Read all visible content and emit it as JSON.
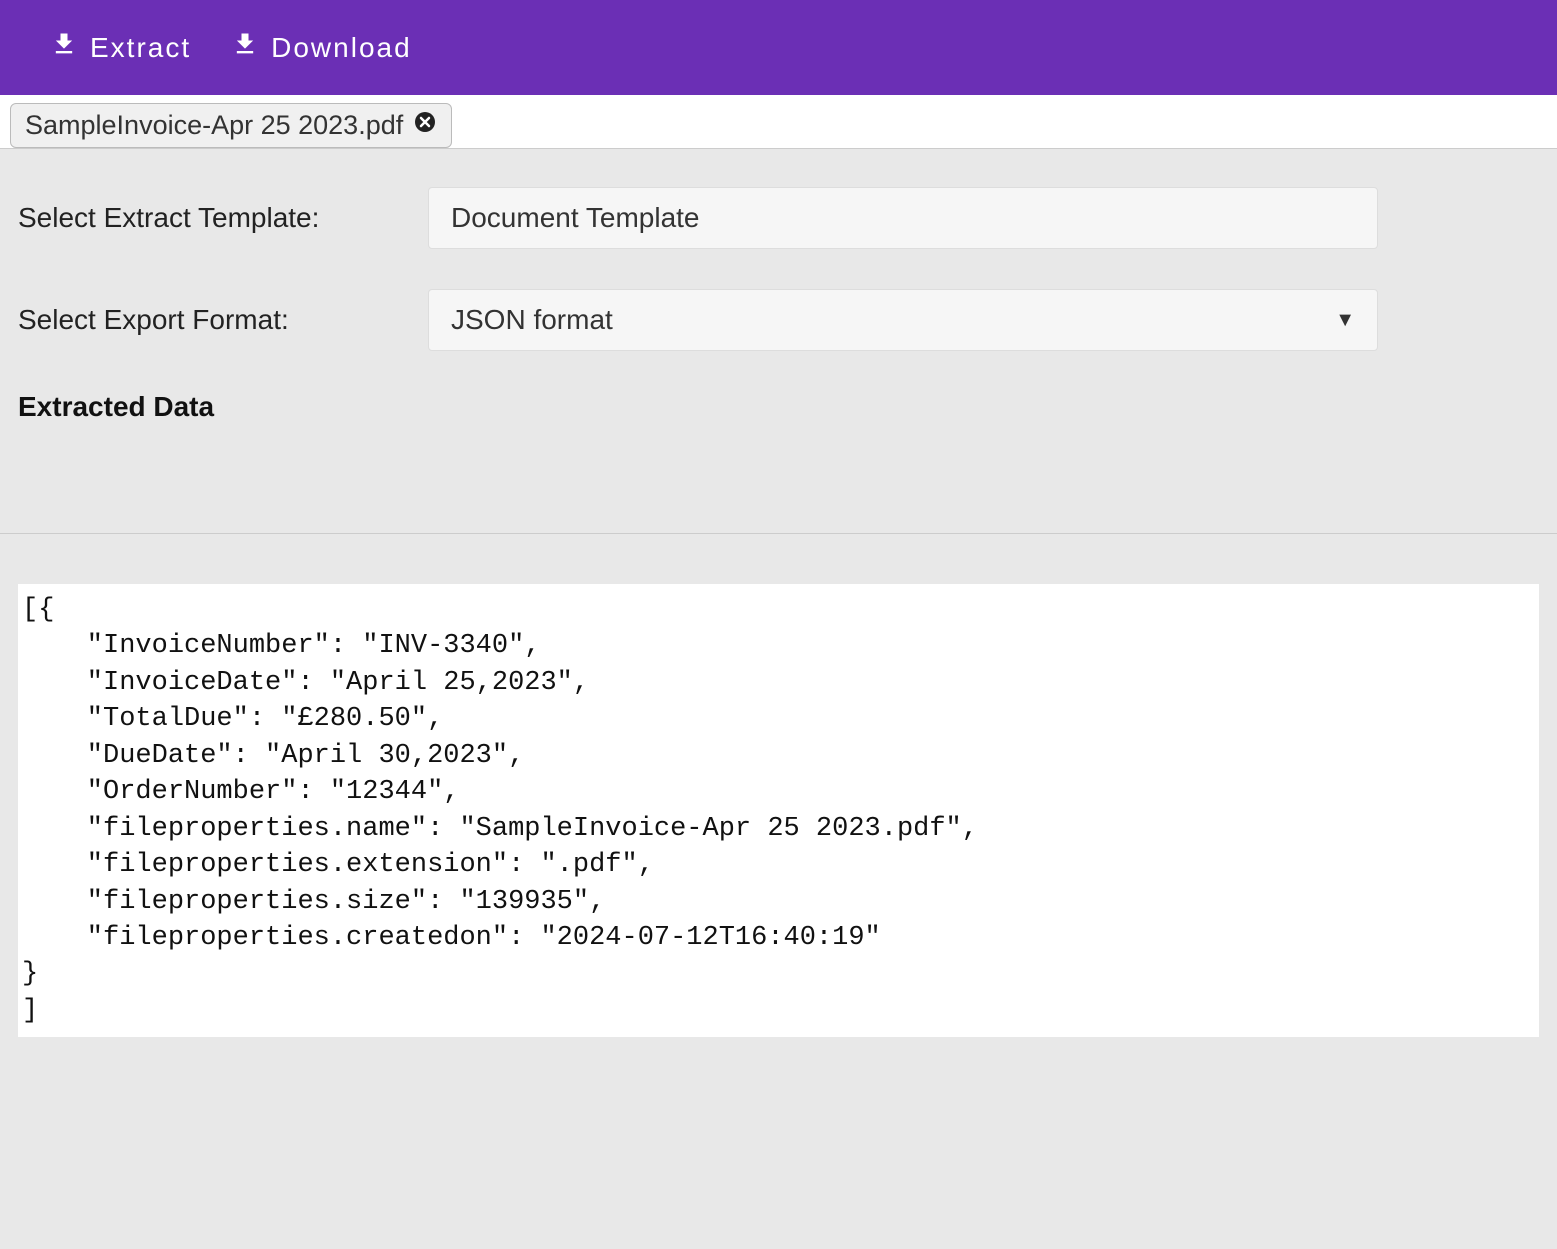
{
  "toolbar": {
    "extract_label": "Extract",
    "download_label": "Download"
  },
  "file_tab": {
    "name": "SampleInvoice-Apr 25 2023.pdf"
  },
  "form": {
    "template_label": "Select Extract Template:",
    "template_value": "Document Template",
    "format_label": "Select Export Format:",
    "format_value": "JSON format"
  },
  "section_heading": "Extracted Data",
  "output_text": "[{\n    \"InvoiceNumber\": \"INV-3340\",\n    \"InvoiceDate\": \"April 25,2023\",\n    \"TotalDue\": \"£280.50\",\n    \"DueDate\": \"April 30,2023\",\n    \"OrderNumber\": \"12344\",\n    \"fileproperties.name\": \"SampleInvoice-Apr 25 2023.pdf\",\n    \"fileproperties.extension\": \".pdf\",\n    \"fileproperties.size\": \"139935\",\n    \"fileproperties.createdon\": \"2024-07-12T16:40:19\"\n}\n]"
}
